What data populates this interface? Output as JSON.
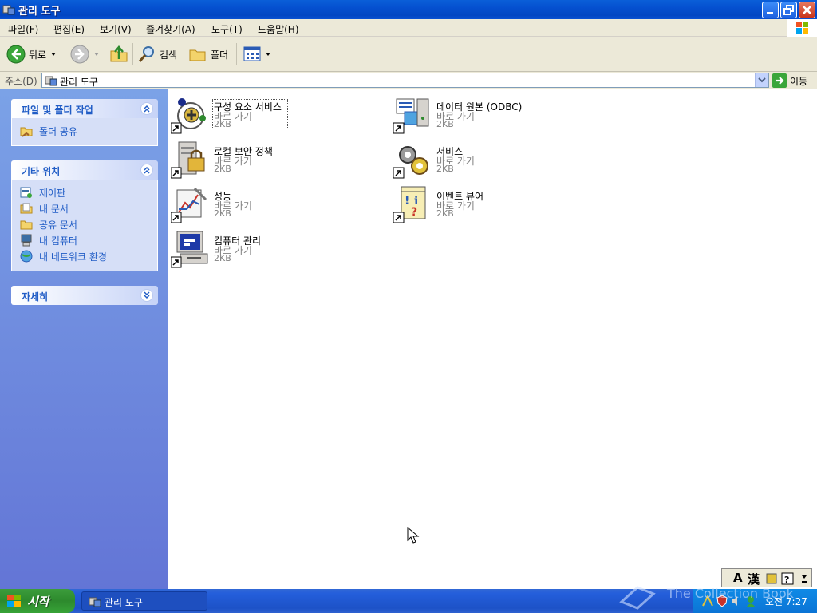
{
  "window": {
    "title": "관리 도구"
  },
  "menu": [
    "파일(F)",
    "편집(E)",
    "보기(V)",
    "즐겨찾기(A)",
    "도구(T)",
    "도움말(H)"
  ],
  "toolbar": {
    "back": "뒤로",
    "search": "검색",
    "folders": "폴더"
  },
  "address": {
    "label": "주소(D)",
    "value": "관리 도구",
    "go": "이동"
  },
  "sidebar": {
    "tasks": {
      "title": "파일 및 폴더 작업",
      "items": [
        "폴더 공유"
      ]
    },
    "places": {
      "title": "기타 위치",
      "items": [
        "제어판",
        "내 문서",
        "공유 문서",
        "내 컴퓨터",
        "내 네트워크 환경"
      ]
    },
    "details": {
      "title": "자세히"
    }
  },
  "files": [
    {
      "name": "구성 요소 서비스",
      "type": "바로 가기",
      "size": "2KB"
    },
    {
      "name": "데이터 원본 (ODBC)",
      "type": "바로 가기",
      "size": "2KB"
    },
    {
      "name": "로컬 보안 정책",
      "type": "바로 가기",
      "size": "2KB"
    },
    {
      "name": "서비스",
      "type": "바로 가기",
      "size": "2KB"
    },
    {
      "name": "성능",
      "type": "바로 가기",
      "size": "2KB"
    },
    {
      "name": "이벤트 뷰어",
      "type": "바로 가기",
      "size": "2KB"
    },
    {
      "name": "컴퓨터 관리",
      "type": "바로 가기",
      "size": "2KB"
    }
  ],
  "taskbar": {
    "start": "시작",
    "task": "관리 도구",
    "clock": "오전 7:27"
  },
  "ime": {
    "mode1": "A",
    "mode2": "漢"
  },
  "watermark": "The Collection Book",
  "colors": {
    "titlebar": "#0a5fd8",
    "sidebar": "#7ba2e7",
    "link": "#215dc6",
    "start": "#3c9c3c"
  }
}
